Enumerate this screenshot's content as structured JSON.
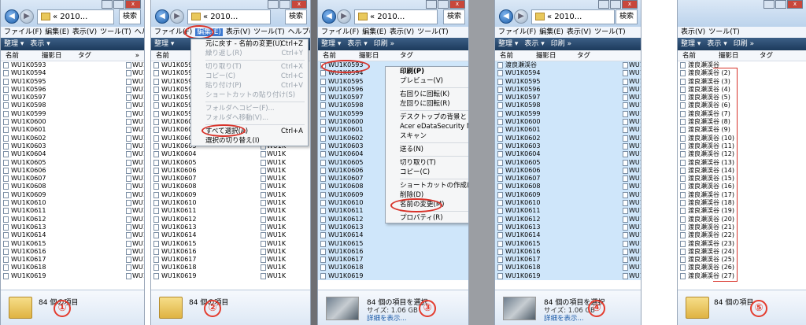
{
  "address_text": "« 2010...",
  "search_label": "検索",
  "menubar": [
    "ファイル(F)",
    "編集(E)",
    "表示(V)",
    "ツール(T)",
    "ヘルプ(H)"
  ],
  "toolbar": {
    "organize": "整理 ▾",
    "views": "表示 ▾",
    "print": "印刷 »"
  },
  "columns": {
    "name": "名前",
    "date": "撮影日",
    "tag": "タグ",
    "more": "»"
  },
  "files": [
    "WU1K0593",
    "WU1K0594",
    "WU1K0595",
    "WU1K0596",
    "WU1K0597",
    "WU1K0598",
    "WU1K0599",
    "WU1K0600",
    "WU1K0601",
    "WU1K0602",
    "WU1K0603",
    "WU1K0604",
    "WU1K0605",
    "WU1K0606",
    "WU1K0607",
    "WU1K0608",
    "WU1K0609",
    "WU1K0610",
    "WU1K0611",
    "WU1K0612",
    "WU1K0613",
    "WU1K0614",
    "WU1K0615",
    "WU1K0616",
    "WU1K0617",
    "WU1K0618",
    "WU1K0619"
  ],
  "right_col_label": "WU1K",
  "renamed_first": "渡良瀬渓谷",
  "renamed_seq": [
    "渡良瀬渓谷",
    "渡良瀬渓谷 (2)",
    "渡良瀬渓谷 (3)",
    "渡良瀬渓谷 (4)",
    "渡良瀬渓谷 (5)",
    "渡良瀬渓谷 (6)",
    "渡良瀬渓谷 (7)",
    "渡良瀬渓谷 (8)",
    "渡良瀬渓谷 (9)",
    "渡良瀬渓谷 (10)",
    "渡良瀬渓谷 (11)",
    "渡良瀬渓谷 (12)",
    "渡良瀬渓谷 (13)",
    "渡良瀬渓谷 (14)",
    "渡良瀬渓谷 (15)",
    "渡良瀬渓谷 (16)",
    "渡良瀬渓谷 (17)",
    "渡良瀬渓谷 (18)",
    "渡良瀬渓谷 (19)",
    "渡良瀬渓谷 (20)",
    "渡良瀬渓谷 (21)",
    "渡良瀬渓谷 (22)",
    "渡良瀬渓谷 (23)",
    "渡良瀬渓谷 (24)",
    "渡良瀬渓谷 (25)",
    "渡良瀬渓谷 (26)",
    "渡良瀬渓谷 (27)"
  ],
  "status": {
    "count": "84 個の項目",
    "selected": "84 個の項目を選択",
    "size": "サイズ: 1.06 GB",
    "details": "詳細を表示..."
  },
  "edit_menu": [
    {
      "label": "元に戻す - 名前の変更(U)",
      "shortcut": "Ctrl+Z",
      "disabled": false
    },
    {
      "label": "繰り返し(R)",
      "shortcut": "Ctrl+Y",
      "disabled": true
    },
    {
      "sep": true
    },
    {
      "label": "切り取り(T)",
      "shortcut": "Ctrl+X",
      "disabled": true
    },
    {
      "label": "コピー(C)",
      "shortcut": "Ctrl+C",
      "disabled": true
    },
    {
      "label": "貼り付け(P)",
      "shortcut": "Ctrl+V",
      "disabled": true
    },
    {
      "label": "ショートカットの貼り付け(S)",
      "shortcut": "",
      "disabled": true
    },
    {
      "sep": true
    },
    {
      "label": "フォルダへコピー(F)...",
      "shortcut": "",
      "disabled": true
    },
    {
      "label": "フォルダへ移動(V)...",
      "shortcut": "",
      "disabled": true
    },
    {
      "sep": true
    },
    {
      "label": "すべて選択(A)",
      "shortcut": "Ctrl+A",
      "disabled": false
    },
    {
      "label": "選択の切り替え(I)",
      "shortcut": "",
      "disabled": false
    }
  ],
  "context_menu": [
    {
      "label": "印刷(P)",
      "bold": true
    },
    {
      "label": "プレビュー(V)"
    },
    {
      "sep": true
    },
    {
      "label": "右回りに回転(K)"
    },
    {
      "label": "左回りに回転(R)"
    },
    {
      "sep": true
    },
    {
      "label": "デスクトップの背景として設定(B)"
    },
    {
      "label": "Acer eDataSecurity Management"
    },
    {
      "label": "スキャン"
    },
    {
      "sep": true
    },
    {
      "label": "送る(N)"
    },
    {
      "sep": true
    },
    {
      "label": "切り取り(T)"
    },
    {
      "label": "コピー(C)"
    },
    {
      "sep": true
    },
    {
      "label": "ショートカットの作成(S)"
    },
    {
      "label": "削除(D)"
    },
    {
      "label": "名前の変更(M)"
    },
    {
      "sep": true
    },
    {
      "label": "プロパティ(R)"
    }
  ],
  "step_labels": [
    "①",
    "②",
    "③",
    "④",
    "⑤"
  ]
}
